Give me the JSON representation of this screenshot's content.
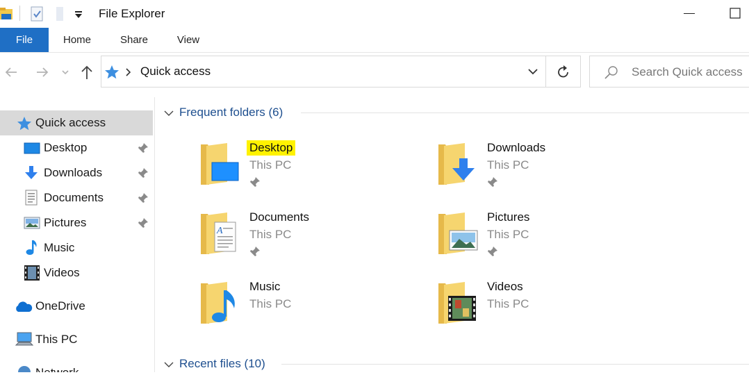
{
  "window": {
    "title": "File Explorer"
  },
  "ribbon": {
    "tabs": [
      "File",
      "Home",
      "Share",
      "View"
    ]
  },
  "address": {
    "location": "Quick access",
    "search_placeholder": "Search Quick access"
  },
  "sidebar": {
    "items": [
      {
        "label": "Quick access",
        "icon": "star-icon",
        "selected": true
      },
      {
        "label": "Desktop",
        "icon": "desktop-icon",
        "pinned": true
      },
      {
        "label": "Downloads",
        "icon": "download-arrow-icon",
        "pinned": true
      },
      {
        "label": "Documents",
        "icon": "document-icon",
        "pinned": true
      },
      {
        "label": "Pictures",
        "icon": "picture-icon",
        "pinned": true
      },
      {
        "label": "Music",
        "icon": "music-note-icon"
      },
      {
        "label": "Videos",
        "icon": "film-icon"
      },
      {
        "label": "OneDrive",
        "icon": "cloud-icon"
      },
      {
        "label": "This PC",
        "icon": "computer-icon"
      },
      {
        "label": "Network",
        "icon": "network-icon"
      }
    ]
  },
  "content": {
    "frequent_header": "Frequent folders (6)",
    "recent_header": "Recent files (10)",
    "folders": [
      {
        "name": "Desktop",
        "location": "This PC",
        "pinned": true,
        "highlighted": true,
        "overlay": "desktop-overlay-icon"
      },
      {
        "name": "Downloads",
        "location": "This PC",
        "pinned": true,
        "overlay": "download-overlay-icon"
      },
      {
        "name": "Documents",
        "location": "This PC",
        "pinned": true,
        "overlay": "document-overlay-icon"
      },
      {
        "name": "Pictures",
        "location": "This PC",
        "pinned": true,
        "overlay": "picture-overlay-icon"
      },
      {
        "name": "Music",
        "location": "This PC",
        "pinned": false,
        "overlay": "music-overlay-icon"
      },
      {
        "name": "Videos",
        "location": "This PC",
        "pinned": false,
        "overlay": "film-overlay-icon"
      }
    ]
  },
  "colors": {
    "accent": "#1f6fc5",
    "section_header": "#1e4f8f",
    "folder": "#f6d56f",
    "highlight": "#fff200"
  }
}
